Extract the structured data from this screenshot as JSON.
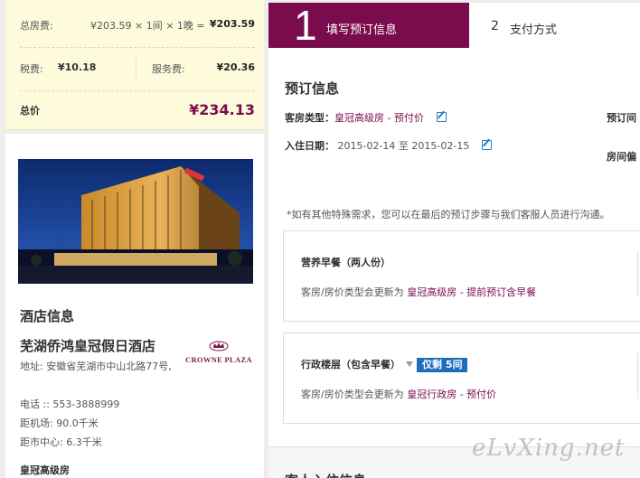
{
  "price": {
    "room_label": "总房费:",
    "room_formula": "¥203.59 × 1间 × 1晚 =",
    "room_total": "¥203.59",
    "tax_label": "税费:",
    "tax_value": "¥10.18",
    "service_label": "服务费:",
    "service_value": "¥20.36",
    "total_label": "总价",
    "total_value": "¥234.13"
  },
  "hotel": {
    "section_title": "酒店信息",
    "name": "芜湖侨鸿皇冠假日酒店",
    "logo_text": "CROWNE PLAZA",
    "address": "地址: 安徽省芜湖市中山北路77号,",
    "phone": "电话 :: 553-3888999",
    "airport": "距机场: 90.0千米",
    "center": "距市中心: 6.3千米",
    "room_name": "皇冠高级房"
  },
  "steps": {
    "step1_num": "1",
    "step1_label": "填写预订信息",
    "step2_num": "2",
    "step2_label": "支付方式"
  },
  "booking": {
    "section_title": "预订信息",
    "room_type_label": "客房类型：",
    "room_type_value": "皇冠高级房 - 预付价",
    "date_label": "入住日期：",
    "date_value": "2015-02-14 至 2015-02-15",
    "right_label1": "预订间",
    "right_label2": "房间偏",
    "note": "*如有其他特殊需求，您可以在最后的预订步骤与我们客服人员进行沟通。"
  },
  "options": [
    {
      "title": "营养早餐（两人份）",
      "desc_prefix": "客房/房价类型会更新为",
      "desc_value": "皇冠高级房 - 提前预订含早餐"
    },
    {
      "title": "行政楼层（包含早餐）",
      "badge": "仅剩 5间",
      "desc_prefix": "客房/房价类型会更新为",
      "desc_value": "皇冠行政房 - 预付价"
    }
  ],
  "guest": {
    "section_title": "客人入住信息"
  },
  "watermark": "eLvXing.net",
  "colors": {
    "brand": "#7a0c4d",
    "badge": "#1c6fb8",
    "price_box": "#fdfbdc"
  }
}
